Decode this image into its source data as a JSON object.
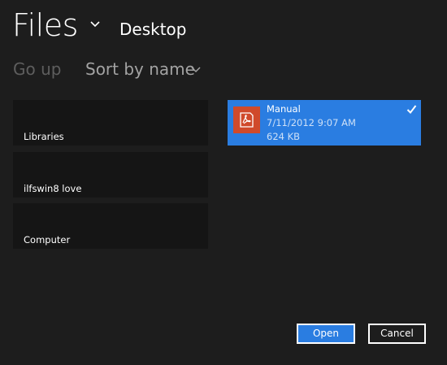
{
  "header": {
    "title": "Files",
    "location": "Desktop"
  },
  "toolbar": {
    "go_up_label": "Go up",
    "sort_label": "Sort by name"
  },
  "locations": [
    {
      "label": "Libraries"
    },
    {
      "label": "ilfswin8 love"
    },
    {
      "label": "Computer"
    }
  ],
  "selected_file": {
    "name": "Manual",
    "date": "7/11/2012 9:07 AM",
    "size": "624 KB",
    "selected": true,
    "icon": "pdf-reader-icon"
  },
  "actions": {
    "open_label": "Open",
    "cancel_label": "Cancel"
  },
  "colors": {
    "background": "#1d1d1d",
    "tile": "#151515",
    "accent": "#2a7de1",
    "file_icon": "#d04a2b",
    "disabled_text": "#5e5e5e"
  }
}
